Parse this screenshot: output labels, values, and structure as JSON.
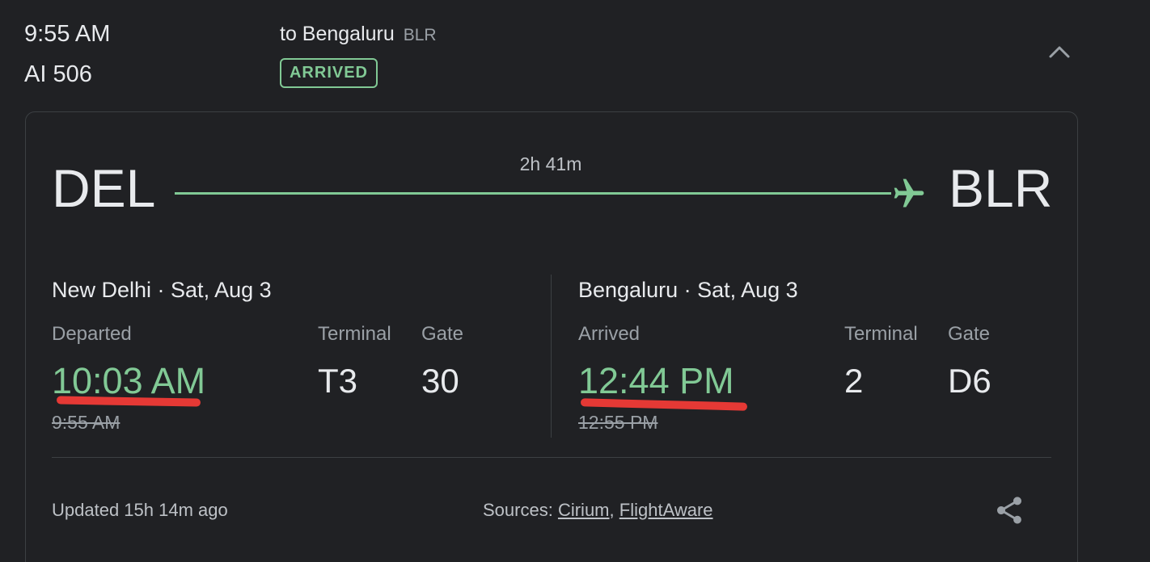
{
  "summary": {
    "scheduled_time": "9:55 AM",
    "flight_number": "AI 506",
    "destination_prefix": "to Bengaluru",
    "destination_code": "BLR",
    "status": "ARRIVED"
  },
  "route": {
    "from_code": "DEL",
    "to_code": "BLR",
    "duration": "2h 41m"
  },
  "departure": {
    "city_date": "New Delhi · Sat, Aug 3",
    "status_label": "Departed",
    "actual_time": "10:03 AM",
    "scheduled_time": "9:55 AM",
    "terminal_label": "Terminal",
    "terminal": "T3",
    "gate_label": "Gate",
    "gate": "30"
  },
  "arrival": {
    "city_date": "Bengaluru · Sat, Aug 3",
    "status_label": "Arrived",
    "actual_time": "12:44 PM",
    "scheduled_time": "12:55 PM",
    "terminal_label": "Terminal",
    "terminal": "2",
    "gate_label": "Gate",
    "gate": "D6"
  },
  "footer": {
    "updated": "Updated 15h 14m ago",
    "sources_label": "Sources:",
    "source_1": "Cirium",
    "separator": ",",
    "source_2": "FlightAware"
  },
  "icons": {
    "collapse": "chevron-up-icon",
    "plane": "airplane-icon",
    "share": "share-icon"
  },
  "colors": {
    "accent_green": "#81c995",
    "annotation_red": "#e53935",
    "background": "#202124"
  }
}
